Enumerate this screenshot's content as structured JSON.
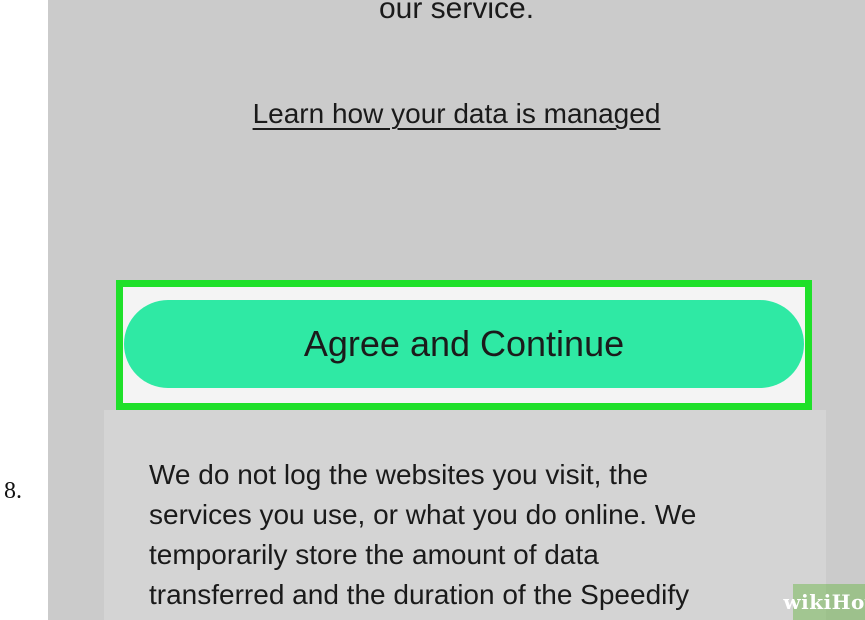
{
  "step": {
    "number": "8."
  },
  "consent": {
    "top_text": "our service.",
    "learn_link": "Learn how your data is managed",
    "agree_button": "Agree and Continue",
    "info_lines": [
      "We do not log the websites you visit, the",
      "services you use, or what you do online. We",
      "temporarily store the amount of data",
      "transferred and the duration of the Speedify"
    ]
  },
  "watermark": {
    "text": "wikiHow"
  },
  "colors": {
    "screen_bg": "#cbcbcb",
    "button": "#2fe9a4",
    "highlight": "#1fe02a"
  }
}
